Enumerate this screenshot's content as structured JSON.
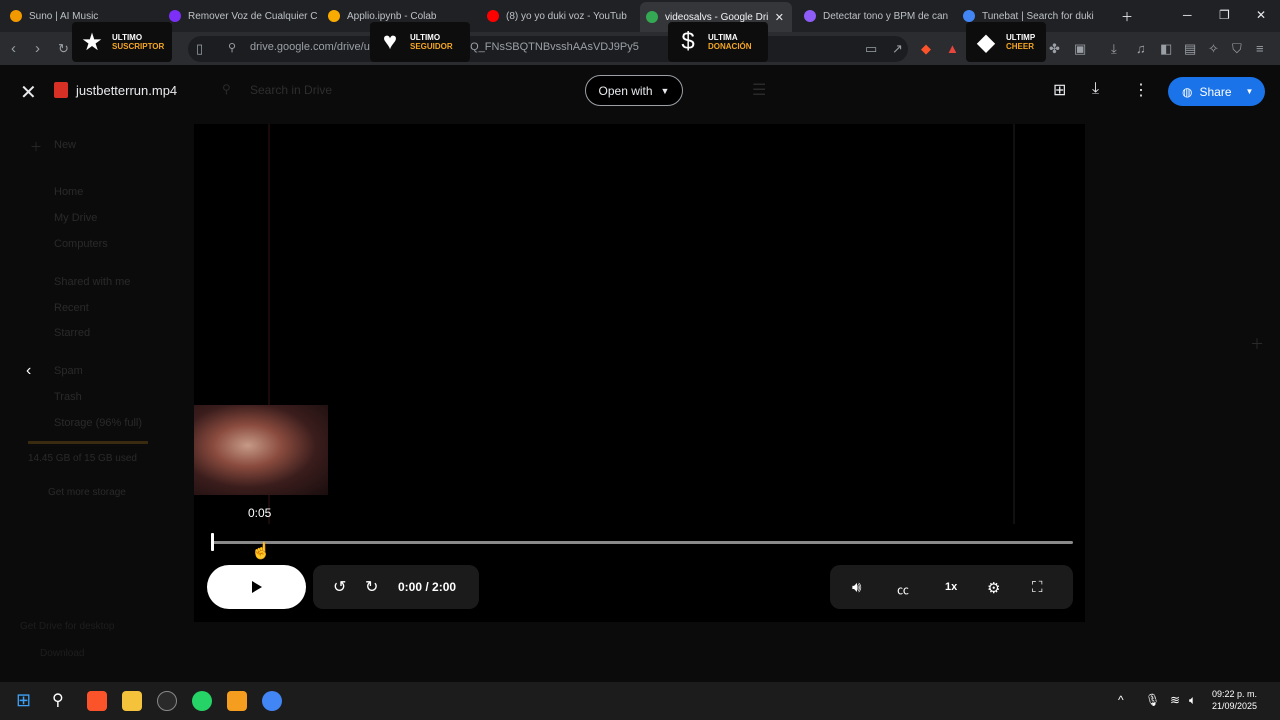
{
  "browser": {
    "tabs": [
      {
        "title": "Suno | AI Music",
        "favicon": "suno-icon",
        "color": "#f29900"
      },
      {
        "title": "Remover Voz de Cualquier C",
        "favicon": "vocalremover-icon",
        "color": "#7b2ff7"
      },
      {
        "title": "Applio.ipynb - Colab",
        "favicon": "colab-icon",
        "color": "#f9ab00"
      },
      {
        "title": "(8) yo yo duki voz - YouTub",
        "favicon": "youtube-icon",
        "color": "#ff0000"
      },
      {
        "title": "videosalvs - Google Dri",
        "favicon": "drive-icon",
        "color": "#34a853",
        "active": true
      },
      {
        "title": "Detectar tono y BPM de can",
        "favicon": "v-icon",
        "color": "#8e5cf7"
      },
      {
        "title": "Tunebat | Search for duki",
        "favicon": "tunebat-icon",
        "color": "#4285f4"
      }
    ],
    "url": "drive.google.com/drive/u/2/folders/1e-4MUXkQ_FNsSBQTNBvsshAAsVDJ9Py5"
  },
  "overlays": [
    {
      "icon": "star-icon",
      "line1": "ULTIMO",
      "line2": "SUSCRIPTOR"
    },
    {
      "icon": "heart-icon",
      "line1": "ULTIMO",
      "line2": "SEGUIDOR"
    },
    {
      "icon": "dollar-icon",
      "line1": "ULTIMA",
      "line2": "DONACIÓN"
    },
    {
      "icon": "diamond-icon",
      "line1": "ULTIMP",
      "line2": "CHEER"
    }
  ],
  "drive_bg": {
    "new_label": "New",
    "sidebar": [
      "Home",
      "My Drive",
      "Computers",
      "Shared with me",
      "Recent",
      "Starred",
      "Spam",
      "Trash",
      "Storage (96% full)"
    ],
    "storage_text": "14.45 GB of 15 GB used",
    "get_storage": "Get more storage",
    "desktop_promo": "Get Drive for desktop",
    "download": "Download",
    "search_placeholder": "Search in Drive"
  },
  "viewer": {
    "filename": "justbetterrun.mp4",
    "open_with": "Open with",
    "share": "Share"
  },
  "player": {
    "hover_time": "0:05",
    "timecode": "0:00 / 2:00",
    "speed": "1x",
    "progress": 0
  },
  "taskbar": {
    "time": "09:22 p. m.",
    "date": "21/09/2025"
  }
}
